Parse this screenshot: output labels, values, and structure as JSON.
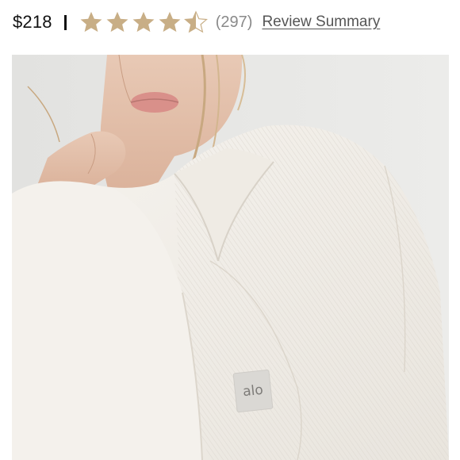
{
  "product": {
    "price": "$218",
    "rating": {
      "value": 4.5,
      "max": 5,
      "star_color": "#c8ae86",
      "count": "(297)"
    },
    "review_summary_link": "Review Summary"
  },
  "image": {
    "subject": "Model wearing a white ribbed knit V-neck sweater",
    "brand_label": "alo"
  },
  "colors": {
    "price_text": "#111111",
    "count_text": "#8a8a8a",
    "link_text": "#555555"
  }
}
